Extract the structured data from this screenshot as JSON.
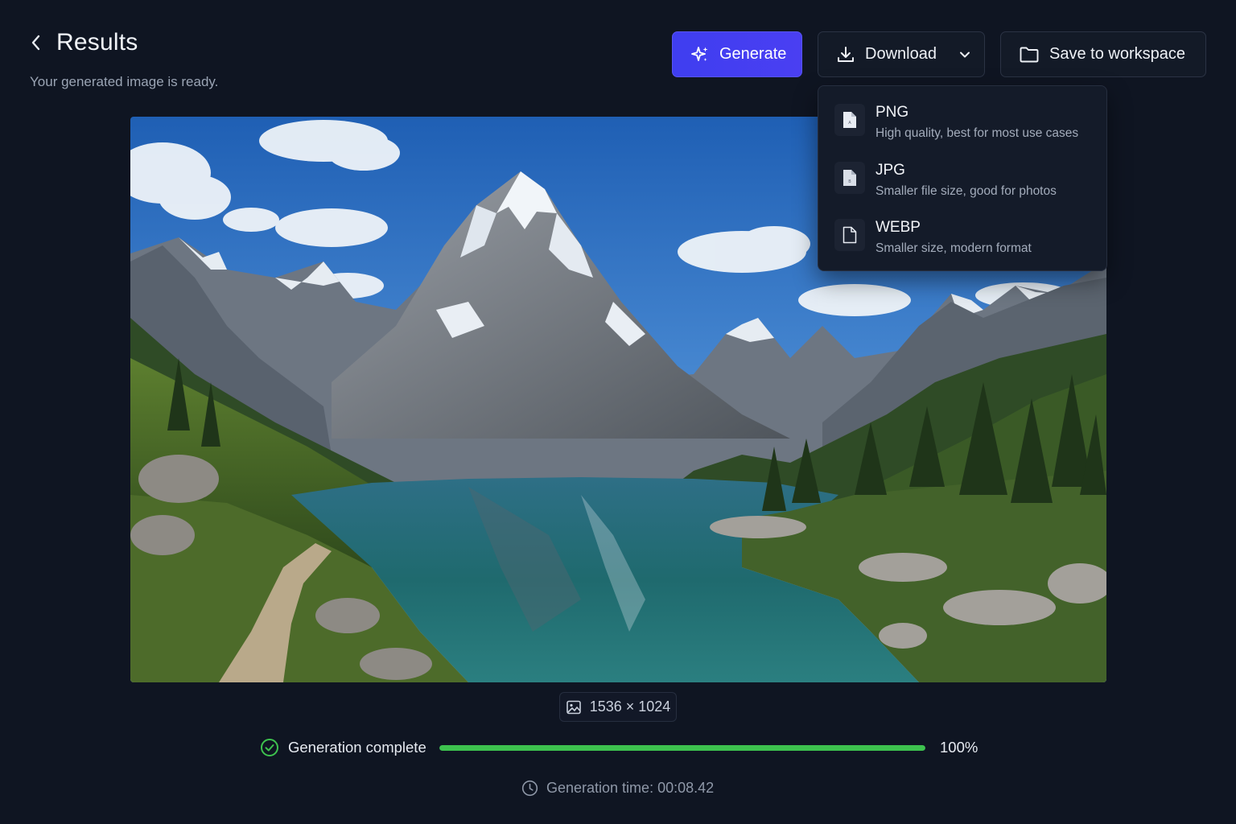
{
  "header": {
    "title": "Results",
    "subtitle": "Your generated image is ready."
  },
  "toolbar": {
    "generate_label": "Generate",
    "download_label": "Download",
    "save_label": "Save to workspace"
  },
  "download_menu": {
    "items": [
      {
        "label": "PNG",
        "description": "High quality, best for most use cases",
        "icon": "png-file-icon"
      },
      {
        "label": "JPG",
        "description": "Smaller file size, good for photos",
        "icon": "jpg-file-icon"
      },
      {
        "label": "WEBP",
        "description": "Smaller size, modern format",
        "icon": "webp-file-icon"
      }
    ]
  },
  "result": {
    "image_subject": "alpine mountain lake landscape",
    "dimensions": "1536 × 1024"
  },
  "progress": {
    "status": "Generation complete",
    "percent_label": "100%",
    "fraction": 1.0
  },
  "generation_time": "Generation time: 00:08.42",
  "colors": {
    "background": "#0f1522",
    "accent": "#4240f1",
    "success": "#3dc24e"
  }
}
